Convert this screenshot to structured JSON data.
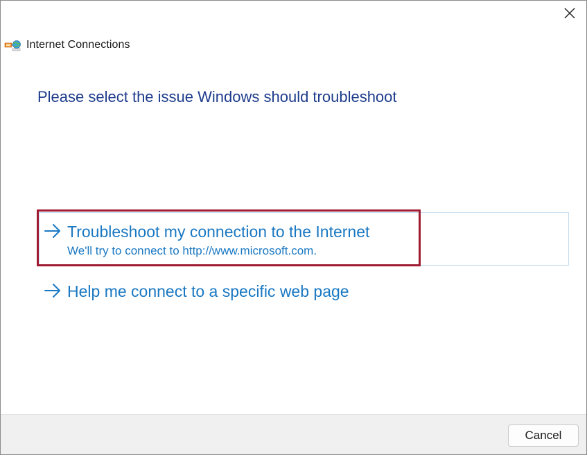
{
  "window": {
    "title": "Internet Connections",
    "icon": "network-troubleshooter-icon"
  },
  "heading": "Please select the issue Windows should troubleshoot",
  "options": [
    {
      "title": "Troubleshoot my connection to the Internet",
      "description": "We'll try to connect to http://www.microsoft.com.",
      "icon": "arrow-right-icon"
    },
    {
      "title": "Help me connect to a specific web page",
      "icon": "arrow-right-icon"
    }
  ],
  "footer": {
    "cancel_label": "Cancel"
  },
  "colors": {
    "heading": "#1e3c8c",
    "link": "#1a78c2",
    "highlight": "#9e1b32",
    "footer_bg": "#f0f0f0"
  }
}
